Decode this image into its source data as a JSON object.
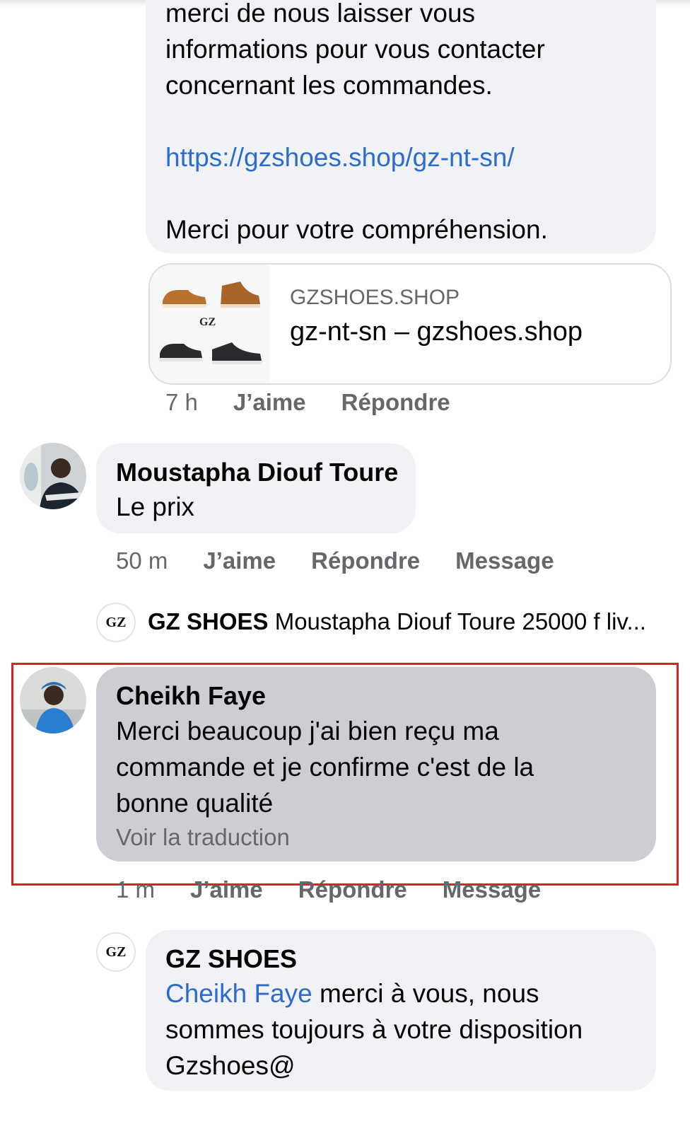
{
  "shop_reply_1": {
    "line_partial": "merci de nous laisser vous",
    "line_2": "informations pour vous contacter",
    "line_3": "concernant les commandes.",
    "link": "https://gzshoes.shop/gz-nt-sn/",
    "thanks": "Merci pour votre compréhension.",
    "preview_domain": "GZSHOES.SHOP",
    "preview_title": "gz-nt-sn – gzshoes.shop",
    "logo_text": "GZ",
    "time": "7 h",
    "like": "J’aime",
    "reply": "Répondre"
  },
  "comment_1": {
    "author": "Moustapha Diouf Toure",
    "text": "Le prix",
    "time": "50 m",
    "like": "J’aime",
    "reply": "Répondre",
    "message": "Message"
  },
  "collapsed_reply": {
    "logo_text": "GZ",
    "author": "GZ SHOES",
    "snippet": "Moustapha Diouf Toure 25000 f liv..."
  },
  "comment_2": {
    "author": "Cheikh Faye",
    "line_1": "Merci beaucoup j'ai bien reçu ma",
    "line_2": "commande et je confirme c'est de la",
    "line_3": "bonne qualité",
    "translate": "Voir la traduction",
    "time": "1 m",
    "like": "J’aime",
    "reply": "Répondre",
    "message": "Message"
  },
  "shop_reply_2": {
    "logo_text": "GZ",
    "author": "GZ SHOES",
    "mention": "Cheikh Faye",
    "line_1_rest": " merci à vous, nous",
    "line_2": "sommes toujours à votre disposition",
    "line_3": "Gzshoes@"
  },
  "colors": {
    "bubble": "#f0f2f5",
    "highlight_bubble": "#ccced3",
    "link": "#2d6bcf",
    "meta": "#65676b",
    "highlight_border": "#e02020"
  }
}
